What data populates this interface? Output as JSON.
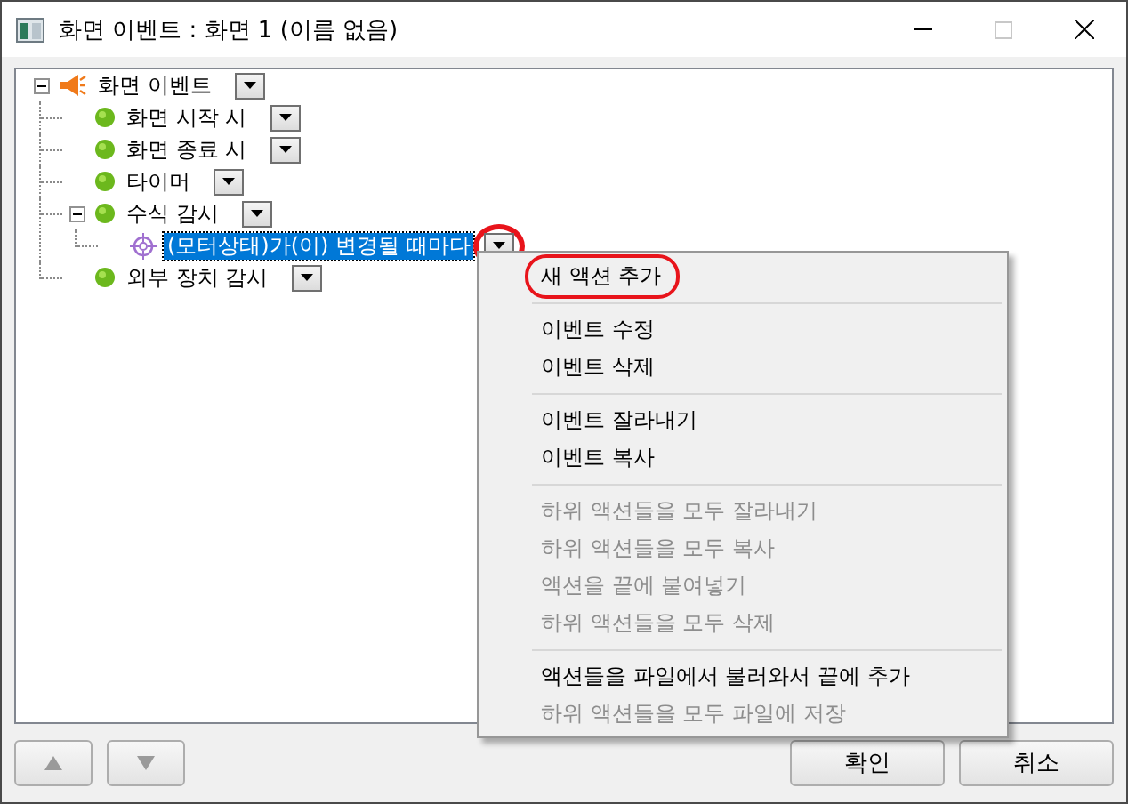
{
  "window": {
    "title": "화면 이벤트 : 화면 1 (이름 없음)",
    "maximize_disabled": true
  },
  "tree": [
    {
      "label": "화면 이벤트",
      "kind": "event",
      "expanded": true,
      "selected": false,
      "highlighted": false,
      "children": [
        {
          "label": "화면 시작 시",
          "kind": "trigger",
          "selected": false,
          "highlighted": false
        },
        {
          "label": "화면 종료 시",
          "kind": "trigger",
          "selected": false,
          "highlighted": false
        },
        {
          "label": "타이머",
          "kind": "trigger",
          "selected": false,
          "highlighted": false
        },
        {
          "label": "수식 감시",
          "kind": "trigger",
          "expanded": true,
          "selected": false,
          "highlighted": false,
          "children": [
            {
              "label": "(모터상태)가(이) 변경될 때마다",
              "kind": "watch",
              "selected": true,
              "highlighted": true
            }
          ]
        },
        {
          "label": "외부 장치 감시",
          "kind": "trigger",
          "selected": false,
          "highlighted": false
        }
      ]
    }
  ],
  "context_menu": {
    "sections": [
      [
        {
          "label": "새 액션 추가",
          "disabled": false,
          "highlighted": true
        }
      ],
      [
        {
          "label": "이벤트 수정",
          "disabled": false,
          "highlighted": false
        },
        {
          "label": "이벤트 삭제",
          "disabled": false,
          "highlighted": false
        }
      ],
      [
        {
          "label": "이벤트 잘라내기",
          "disabled": false,
          "highlighted": false
        },
        {
          "label": "이벤트 복사",
          "disabled": false,
          "highlighted": false
        }
      ],
      [
        {
          "label": "하위 액션들을 모두 잘라내기",
          "disabled": true,
          "highlighted": false
        },
        {
          "label": "하위 액션들을 모두 복사",
          "disabled": true,
          "highlighted": false
        },
        {
          "label": "액션을 끝에 붙여넣기",
          "disabled": true,
          "highlighted": false
        },
        {
          "label": "하위 액션들을 모두 삭제",
          "disabled": true,
          "highlighted": false
        }
      ],
      [
        {
          "label": "액션들을 파일에서 불러와서 끝에 추가",
          "disabled": false,
          "highlighted": false
        },
        {
          "label": "하위 액션들을 모두 파일에 저장",
          "disabled": true,
          "highlighted": false
        }
      ]
    ]
  },
  "buttons": [
    {
      "label": "확인"
    },
    {
      "label": "취소"
    }
  ]
}
